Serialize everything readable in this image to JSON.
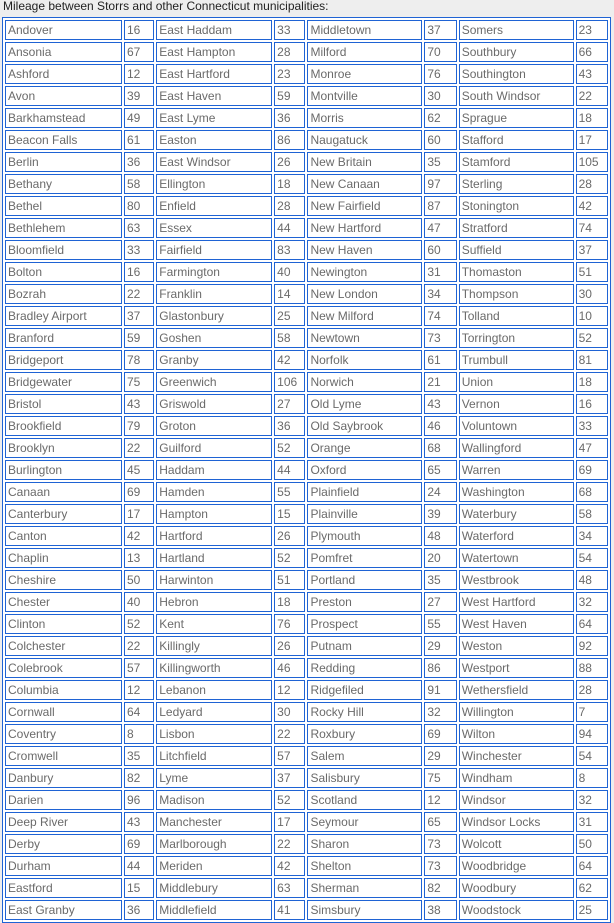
{
  "caption": "Mileage between Storrs and other Connecticut municipalities:",
  "colors": {
    "border": "#1f63d4",
    "text": "#6a6a6a",
    "page_bg": "#eeeeee"
  },
  "rows": [
    [
      [
        "Andover",
        "16"
      ],
      [
        "East Haddam",
        "33"
      ],
      [
        "Middletown",
        "37"
      ],
      [
        "Somers",
        "23"
      ]
    ],
    [
      [
        "Ansonia",
        "67"
      ],
      [
        "East Hampton",
        "28"
      ],
      [
        "Milford",
        "70"
      ],
      [
        "Southbury",
        "66"
      ]
    ],
    [
      [
        "Ashford",
        "12"
      ],
      [
        "East Hartford",
        "23"
      ],
      [
        "Monroe",
        "76"
      ],
      [
        "Southington",
        "43"
      ]
    ],
    [
      [
        "Avon",
        "39"
      ],
      [
        "East Haven",
        "59"
      ],
      [
        "Montville",
        "30"
      ],
      [
        "South Windsor",
        "22"
      ]
    ],
    [
      [
        "Barkhamstead",
        "49"
      ],
      [
        "East Lyme",
        "36"
      ],
      [
        "Morris",
        "62"
      ],
      [
        "Sprague",
        "18"
      ]
    ],
    [
      [
        "Beacon Falls",
        "61"
      ],
      [
        "Easton",
        "86"
      ],
      [
        "Naugatuck",
        "60"
      ],
      [
        "Stafford",
        "17"
      ]
    ],
    [
      [
        "Berlin",
        "36"
      ],
      [
        "East Windsor",
        "26"
      ],
      [
        "New Britain",
        "35"
      ],
      [
        "Stamford",
        "105"
      ]
    ],
    [
      [
        "Bethany",
        "58"
      ],
      [
        "Ellington",
        "18"
      ],
      [
        "New Canaan",
        "97"
      ],
      [
        "Sterling",
        "28"
      ]
    ],
    [
      [
        "Bethel",
        "80"
      ],
      [
        "Enfield",
        "28"
      ],
      [
        "New Fairfield",
        "87"
      ],
      [
        "Stonington",
        "42"
      ]
    ],
    [
      [
        "Bethlehem",
        "63"
      ],
      [
        "Essex",
        "44"
      ],
      [
        "New Hartford",
        "47"
      ],
      [
        "Stratford",
        "74"
      ]
    ],
    [
      [
        "Bloomfield",
        "33"
      ],
      [
        "Fairfield",
        "83"
      ],
      [
        "New Haven",
        "60"
      ],
      [
        "Suffield",
        "37"
      ]
    ],
    [
      [
        "Bolton",
        "16"
      ],
      [
        "Farmington",
        "40"
      ],
      [
        "Newington",
        "31"
      ],
      [
        "Thomaston",
        "51"
      ]
    ],
    [
      [
        "Bozrah",
        "22"
      ],
      [
        "Franklin",
        "14"
      ],
      [
        "New London",
        "34"
      ],
      [
        "Thompson",
        "30"
      ]
    ],
    [
      [
        "Bradley Airport",
        "37"
      ],
      [
        "Glastonbury",
        "25"
      ],
      [
        "New Milford",
        "74"
      ],
      [
        "Tolland",
        "10"
      ]
    ],
    [
      [
        "Branford",
        "59"
      ],
      [
        "Goshen",
        "58"
      ],
      [
        "Newtown",
        "73"
      ],
      [
        "Torrington",
        "52"
      ]
    ],
    [
      [
        "Bridgeport",
        "78"
      ],
      [
        "Granby",
        "42"
      ],
      [
        "Norfolk",
        "61"
      ],
      [
        "Trumbull",
        "81"
      ]
    ],
    [
      [
        "Bridgewater",
        "75"
      ],
      [
        "Greenwich",
        "106"
      ],
      [
        "Norwich",
        "21"
      ],
      [
        "Union",
        "18"
      ]
    ],
    [
      [
        "Bristol",
        "43"
      ],
      [
        "Griswold",
        "27"
      ],
      [
        "Old Lyme",
        "43"
      ],
      [
        "Vernon",
        "16"
      ]
    ],
    [
      [
        "Brookfield",
        "79"
      ],
      [
        "Groton",
        "36"
      ],
      [
        "Old Saybrook",
        "46"
      ],
      [
        "Voluntown",
        "33"
      ]
    ],
    [
      [
        "Brooklyn",
        "22"
      ],
      [
        "Guilford",
        "52"
      ],
      [
        "Orange",
        "68"
      ],
      [
        "Wallingford",
        "47"
      ]
    ],
    [
      [
        "Burlington",
        "45"
      ],
      [
        "Haddam",
        "44"
      ],
      [
        "Oxford",
        "65"
      ],
      [
        "Warren",
        "69"
      ]
    ],
    [
      [
        "Canaan",
        "69"
      ],
      [
        "Hamden",
        "55"
      ],
      [
        "Plainfield",
        "24"
      ],
      [
        "Washington",
        "68"
      ]
    ],
    [
      [
        "Canterbury",
        "17"
      ],
      [
        "Hampton",
        "15"
      ],
      [
        "Plainville",
        "39"
      ],
      [
        "Waterbury",
        "58"
      ]
    ],
    [
      [
        "Canton",
        "42"
      ],
      [
        "Hartford",
        "26"
      ],
      [
        "Plymouth",
        "48"
      ],
      [
        "Waterford",
        "34"
      ]
    ],
    [
      [
        "Chaplin",
        "13"
      ],
      [
        "Hartland",
        "52"
      ],
      [
        "Pomfret",
        "20"
      ],
      [
        "Watertown",
        "54"
      ]
    ],
    [
      [
        "Cheshire",
        "50"
      ],
      [
        "Harwinton",
        "51"
      ],
      [
        "Portland",
        "35"
      ],
      [
        "Westbrook",
        "48"
      ]
    ],
    [
      [
        "Chester",
        "40"
      ],
      [
        "Hebron",
        "18"
      ],
      [
        "Preston",
        "27"
      ],
      [
        "West Hartford",
        "32"
      ]
    ],
    [
      [
        "Clinton",
        "52"
      ],
      [
        "Kent",
        "76"
      ],
      [
        "Prospect",
        "55"
      ],
      [
        "West Haven",
        "64"
      ]
    ],
    [
      [
        "Colchester",
        "22"
      ],
      [
        "Killingly",
        "26"
      ],
      [
        "Putnam",
        "29"
      ],
      [
        "Weston",
        "92"
      ]
    ],
    [
      [
        "Colebrook",
        "57"
      ],
      [
        "Killingworth",
        "46"
      ],
      [
        "Redding",
        "86"
      ],
      [
        "Westport",
        "88"
      ]
    ],
    [
      [
        "Columbia",
        "12"
      ],
      [
        "Lebanon",
        "12"
      ],
      [
        "Ridgefiled",
        "91"
      ],
      [
        "Wethersfield",
        "28"
      ]
    ],
    [
      [
        "Cornwall",
        "64"
      ],
      [
        "Ledyard",
        "30"
      ],
      [
        "Rocky Hill",
        "32"
      ],
      [
        "Willington",
        "7"
      ]
    ],
    [
      [
        "Coventry",
        "8"
      ],
      [
        "Lisbon",
        "22"
      ],
      [
        "Roxbury",
        "69"
      ],
      [
        "Wilton",
        "94"
      ]
    ],
    [
      [
        "Cromwell",
        "35"
      ],
      [
        "Litchfield",
        "57"
      ],
      [
        "Salem",
        "29"
      ],
      [
        "Winchester",
        "54"
      ]
    ],
    [
      [
        "Danbury",
        "82"
      ],
      [
        "Lyme",
        "37"
      ],
      [
        "Salisbury",
        "75"
      ],
      [
        "Windham",
        "8"
      ]
    ],
    [
      [
        "Darien",
        "96"
      ],
      [
        "Madison",
        "52"
      ],
      [
        "Scotland",
        "12"
      ],
      [
        "Windsor",
        "32"
      ]
    ],
    [
      [
        "Deep River",
        "43"
      ],
      [
        "Manchester",
        "17"
      ],
      [
        "Seymour",
        "65"
      ],
      [
        "Windsor Locks",
        "31"
      ]
    ],
    [
      [
        "Derby",
        "69"
      ],
      [
        "Marlborough",
        "22"
      ],
      [
        "Sharon",
        "73"
      ],
      [
        "Wolcott",
        "50"
      ]
    ],
    [
      [
        "Durham",
        "44"
      ],
      [
        "Meriden",
        "42"
      ],
      [
        "Shelton",
        "73"
      ],
      [
        "Woodbridge",
        "64"
      ]
    ],
    [
      [
        "Eastford",
        "15"
      ],
      [
        "Middlebury",
        "63"
      ],
      [
        "Sherman",
        "82"
      ],
      [
        "Woodbury",
        "62"
      ]
    ],
    [
      [
        "East Granby",
        "36"
      ],
      [
        "Middlefield",
        "41"
      ],
      [
        "Simsbury",
        "38"
      ],
      [
        "Woodstock",
        "25"
      ]
    ]
  ]
}
